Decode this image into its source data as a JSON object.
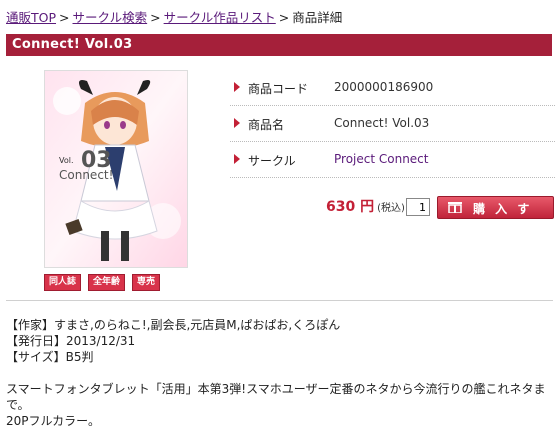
{
  "breadcrumb": {
    "items": [
      "通販TOP",
      "サークル検索",
      "サークル作品リスト"
    ],
    "current": "商品詳細",
    "separator": ">"
  },
  "title": "Connect! Vol.03",
  "cover": {
    "vol_text": "Vol.",
    "vol_number": "03",
    "brand": "Connect!"
  },
  "badges": [
    "同人誌",
    "全年齢",
    "専売"
  ],
  "info": {
    "rows": [
      {
        "label": "商品コード",
        "value": "2000000186900"
      },
      {
        "label": "商品名",
        "value": "Connect! Vol.03"
      },
      {
        "label": "サークル",
        "value": "Project Connect"
      }
    ]
  },
  "purchase": {
    "price": "630 円",
    "tax": "(税込)",
    "quantity": "1",
    "buy_label": "購 入 す る"
  },
  "description": {
    "author": "【作家】すまさ,のらねこ!,副会長,元店員M,ぱおぱお,くろぽん",
    "release": "【発行日】2013/12/31",
    "size": "【サイズ】B5判",
    "body1": "スマートフォンタブレット「活用」本第3弾!スマホユーザー定番のネタから今流行りの艦これネタまで。",
    "body2": "20Pフルカラー。"
  },
  "colors": {
    "accent": "#a5203a",
    "price": "#c32036",
    "link": "#5a1a7a"
  }
}
